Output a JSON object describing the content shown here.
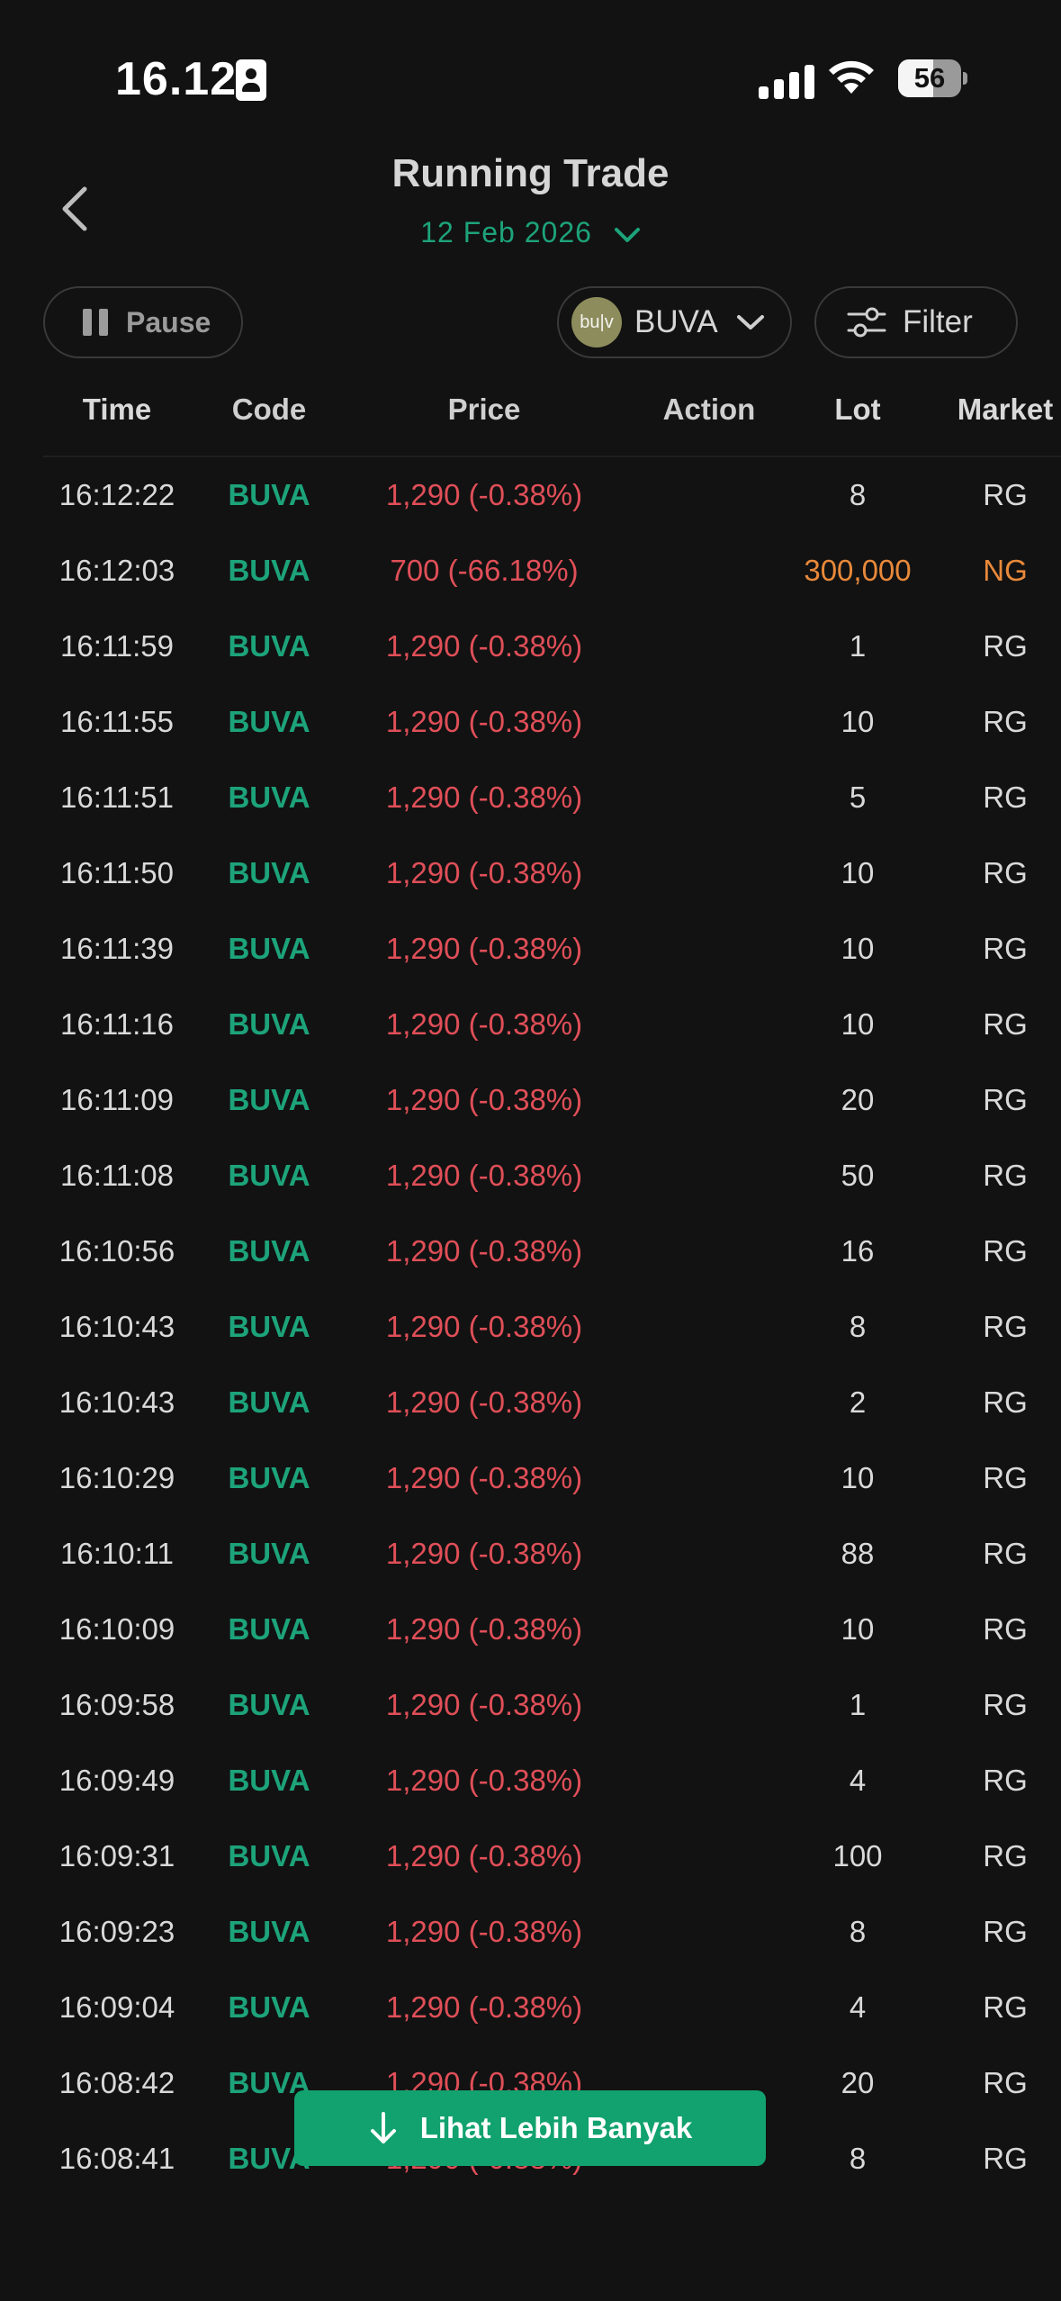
{
  "status_bar": {
    "time": "16.12",
    "battery": "56",
    "battery_level": 0.56
  },
  "header": {
    "title": "Running Trade",
    "date": "12 Feb 2026"
  },
  "controls": {
    "pause_label": "Pause",
    "stock_code": "BUVA",
    "stock_logo_text": "bu|v",
    "filter_label": "Filter"
  },
  "table": {
    "columns": [
      "Time",
      "Code",
      "Price",
      "Action",
      "Lot",
      "Market"
    ],
    "rows": [
      {
        "time": "16:12:22",
        "code": "BUVA",
        "price": "1,290 (-0.38%)",
        "action": "",
        "lot": "8",
        "market": "RG"
      },
      {
        "time": "16:12:03",
        "code": "BUVA",
        "price": "700 (-66.18%)",
        "action": "",
        "lot": "300,000",
        "market": "NG"
      },
      {
        "time": "16:11:59",
        "code": "BUVA",
        "price": "1,290 (-0.38%)",
        "action": "",
        "lot": "1",
        "market": "RG"
      },
      {
        "time": "16:11:55",
        "code": "BUVA",
        "price": "1,290 (-0.38%)",
        "action": "",
        "lot": "10",
        "market": "RG"
      },
      {
        "time": "16:11:51",
        "code": "BUVA",
        "price": "1,290 (-0.38%)",
        "action": "",
        "lot": "5",
        "market": "RG"
      },
      {
        "time": "16:11:50",
        "code": "BUVA",
        "price": "1,290 (-0.38%)",
        "action": "",
        "lot": "10",
        "market": "RG"
      },
      {
        "time": "16:11:39",
        "code": "BUVA",
        "price": "1,290 (-0.38%)",
        "action": "",
        "lot": "10",
        "market": "RG"
      },
      {
        "time": "16:11:16",
        "code": "BUVA",
        "price": "1,290 (-0.38%)",
        "action": "",
        "lot": "10",
        "market": "RG"
      },
      {
        "time": "16:11:09",
        "code": "BUVA",
        "price": "1,290 (-0.38%)",
        "action": "",
        "lot": "20",
        "market": "RG"
      },
      {
        "time": "16:11:08",
        "code": "BUVA",
        "price": "1,290 (-0.38%)",
        "action": "",
        "lot": "50",
        "market": "RG"
      },
      {
        "time": "16:10:56",
        "code": "BUVA",
        "price": "1,290 (-0.38%)",
        "action": "",
        "lot": "16",
        "market": "RG"
      },
      {
        "time": "16:10:43",
        "code": "BUVA",
        "price": "1,290 (-0.38%)",
        "action": "",
        "lot": "8",
        "market": "RG"
      },
      {
        "time": "16:10:43",
        "code": "BUVA",
        "price": "1,290 (-0.38%)",
        "action": "",
        "lot": "2",
        "market": "RG"
      },
      {
        "time": "16:10:29",
        "code": "BUVA",
        "price": "1,290 (-0.38%)",
        "action": "",
        "lot": "10",
        "market": "RG"
      },
      {
        "time": "16:10:11",
        "code": "BUVA",
        "price": "1,290 (-0.38%)",
        "action": "",
        "lot": "88",
        "market": "RG"
      },
      {
        "time": "16:10:09",
        "code": "BUVA",
        "price": "1,290 (-0.38%)",
        "action": "",
        "lot": "10",
        "market": "RG"
      },
      {
        "time": "16:09:58",
        "code": "BUVA",
        "price": "1,290 (-0.38%)",
        "action": "",
        "lot": "1",
        "market": "RG"
      },
      {
        "time": "16:09:49",
        "code": "BUVA",
        "price": "1,290 (-0.38%)",
        "action": "",
        "lot": "4",
        "market": "RG"
      },
      {
        "time": "16:09:31",
        "code": "BUVA",
        "price": "1,290 (-0.38%)",
        "action": "",
        "lot": "100",
        "market": "RG"
      },
      {
        "time": "16:09:23",
        "code": "BUVA",
        "price": "1,290 (-0.38%)",
        "action": "",
        "lot": "8",
        "market": "RG"
      },
      {
        "time": "16:09:04",
        "code": "BUVA",
        "price": "1,290 (-0.38%)",
        "action": "",
        "lot": "4",
        "market": "RG"
      },
      {
        "time": "16:08:42",
        "code": "BUVA",
        "price": "1,290 (-0.38%)",
        "action": "",
        "lot": "20",
        "market": "RG"
      },
      {
        "time": "16:08:41",
        "code": "BUVA",
        "price": "1,290 (-0.38%)",
        "action": "",
        "lot": "8",
        "market": "RG"
      }
    ]
  },
  "footer": {
    "more_label": "Lihat Lebih Banyak"
  },
  "colors": {
    "background": "#121212",
    "accent_green": "#1da37a",
    "price_red": "#e04f58",
    "negotiated_orange": "#e8893a",
    "button_green": "#12a26f"
  },
  "icons": [
    "id-card-icon",
    "signal-icon",
    "wifi-icon",
    "battery-icon",
    "back-chevron-icon",
    "chevron-down-icon",
    "pause-icon",
    "filter-sliders-icon",
    "arrow-down-icon"
  ]
}
